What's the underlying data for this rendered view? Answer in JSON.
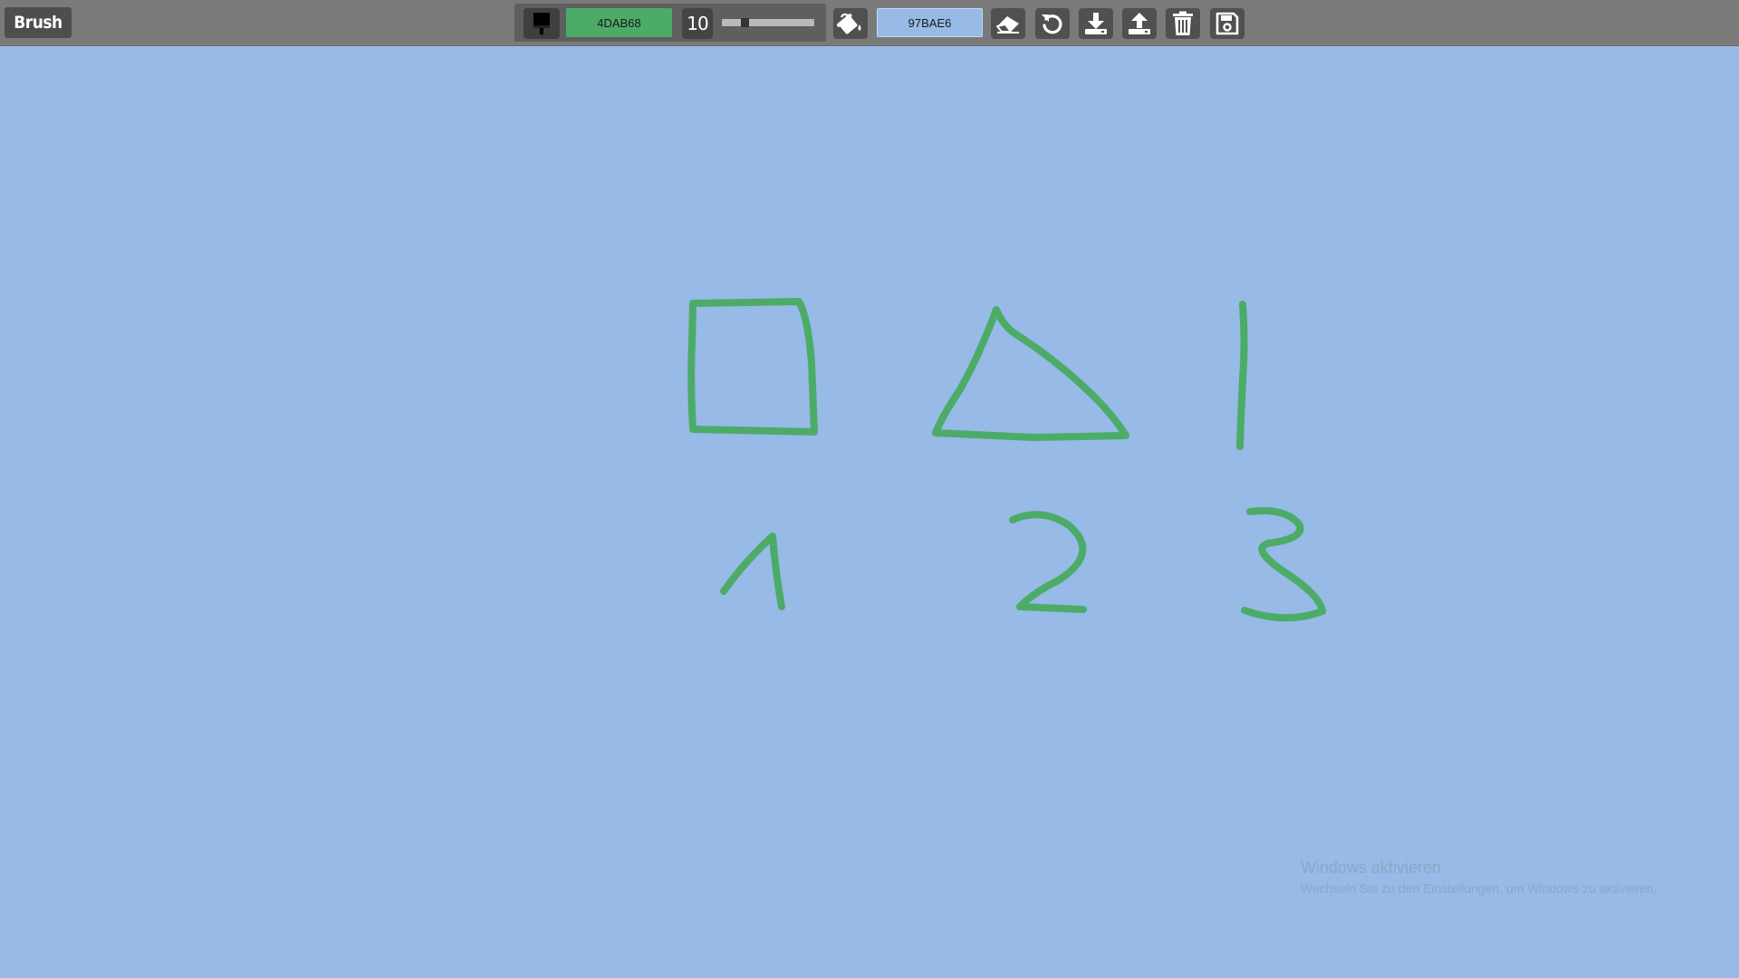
{
  "toolbar": {
    "mode_label": "Brush",
    "brush_color_hex": "4DAB68",
    "brush_size": "10",
    "brush_size_slider": {
      "min": 1,
      "max": 100,
      "value": 10
    },
    "background_color_hex": "97BAE6",
    "icons": {
      "brush": "paintbrush-icon",
      "fill": "paint-bucket-icon",
      "eraser": "eraser-icon",
      "undo": "undo-icon",
      "download": "download-icon",
      "upload": "upload-icon",
      "clear": "trash-icon",
      "save": "save-icon"
    }
  },
  "colors": {
    "stroke": "#4DAB68",
    "background": "#97BAE6",
    "toolbar": "#7a7a7a"
  },
  "canvas": {
    "drawings": [
      "square",
      "triangle",
      "vertical-line",
      "digit-1",
      "digit-2",
      "digit-3"
    ]
  },
  "watermark": {
    "title": "Windows aktivieren",
    "subtitle": "Wechseln Sie zu den Einstellungen, um Windows zu aktivieren."
  }
}
